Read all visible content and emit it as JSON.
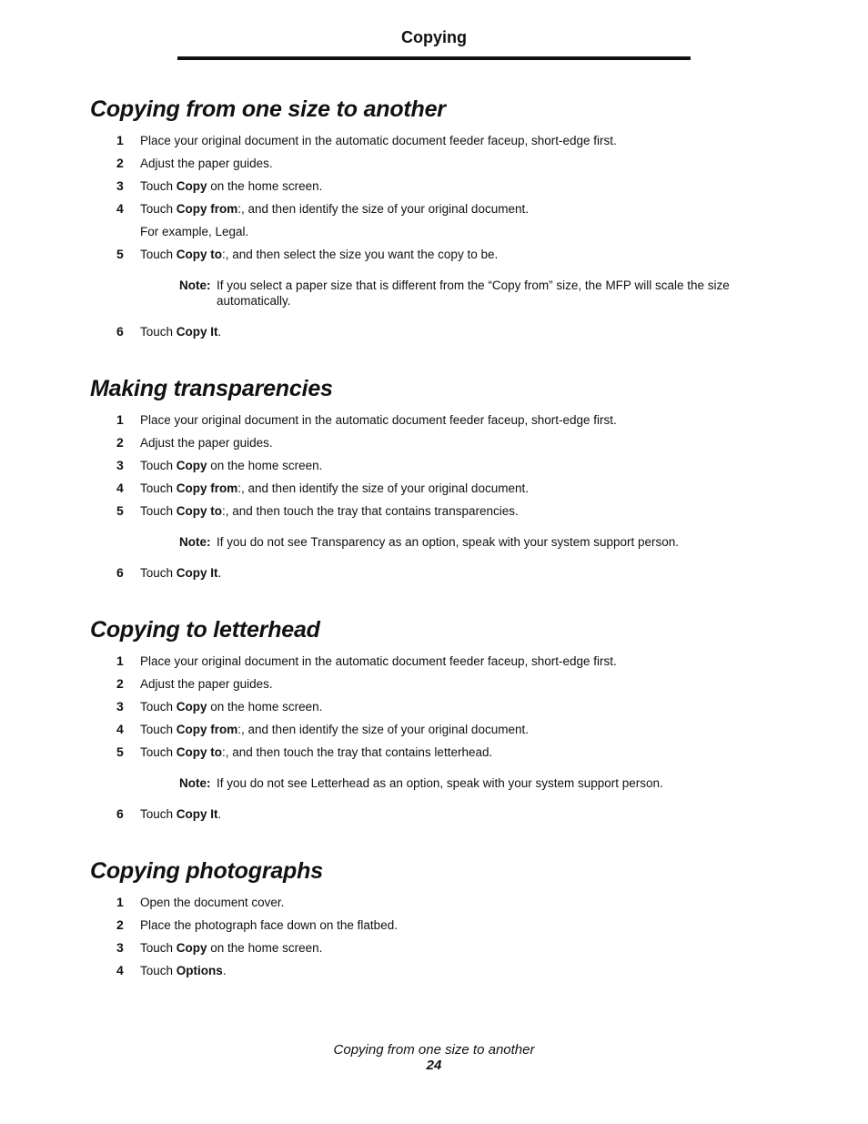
{
  "running_head": "Copying",
  "sections": [
    {
      "title": "Copying from one size to another",
      "steps": [
        {
          "num": "1",
          "pre": "Place your original document in the automatic document feeder faceup, short-edge first.",
          "bold": "",
          "post": ""
        },
        {
          "num": "2",
          "pre": "Adjust the paper guides.",
          "bold": "",
          "post": ""
        },
        {
          "num": "3",
          "pre": "Touch ",
          "bold": "Copy",
          "post": " on the home screen."
        },
        {
          "num": "4",
          "pre": "Touch ",
          "bold": "Copy from",
          "post": ":, and then identify the size of your original document."
        },
        {
          "num": "",
          "pre": "For example, Legal.",
          "bold": "",
          "post": ""
        },
        {
          "num": "5",
          "pre": "Touch ",
          "bold": "Copy to",
          "post": ":, and then select the size you want the copy to be."
        }
      ],
      "note": {
        "label": "Note:",
        "text": "If you select a paper size that is different from the “Copy from” size, the MFP will scale the size automatically."
      },
      "final_step": {
        "num": "6",
        "pre": "Touch ",
        "bold": "Copy It",
        "post": "."
      }
    },
    {
      "title": "Making transparencies",
      "steps": [
        {
          "num": "1",
          "pre": "Place your original document in the automatic document feeder faceup, short-edge first.",
          "bold": "",
          "post": ""
        },
        {
          "num": "2",
          "pre": "Adjust the paper guides.",
          "bold": "",
          "post": ""
        },
        {
          "num": "3",
          "pre": "Touch ",
          "bold": "Copy",
          "post": " on the home screen."
        },
        {
          "num": "4",
          "pre": "Touch ",
          "bold": "Copy from",
          "post": ":, and then identify the size of your original document."
        },
        {
          "num": "5",
          "pre": "Touch ",
          "bold": "Copy to",
          "post": ":, and then touch the tray that contains transparencies."
        }
      ],
      "note": {
        "label": "Note:",
        "text": "If you do not see Transparency as an option, speak with your system support person."
      },
      "final_step": {
        "num": "6",
        "pre": "Touch ",
        "bold": "Copy It",
        "post": "."
      }
    },
    {
      "title": "Copying to letterhead",
      "steps": [
        {
          "num": "1",
          "pre": "Place your original document in the automatic document feeder faceup, short-edge first.",
          "bold": "",
          "post": ""
        },
        {
          "num": "2",
          "pre": "Adjust the paper guides.",
          "bold": "",
          "post": ""
        },
        {
          "num": "3",
          "pre": "Touch ",
          "bold": "Copy",
          "post": " on the home screen."
        },
        {
          "num": "4",
          "pre": "Touch ",
          "bold": "Copy from",
          "post": ":, and then identify the size of your original document."
        },
        {
          "num": "5",
          "pre": "Touch ",
          "bold": "Copy to",
          "post": ":, and then touch the tray that contains letterhead."
        }
      ],
      "note": {
        "label": "Note:",
        "text": "If you do not see Letterhead as an option, speak with your system support person."
      },
      "final_step": {
        "num": "6",
        "pre": "Touch ",
        "bold": "Copy It",
        "post": "."
      }
    },
    {
      "title": "Copying photographs",
      "steps": [
        {
          "num": "1",
          "pre": "Open the document cover.",
          "bold": "",
          "post": ""
        },
        {
          "num": "2",
          "pre": "Place the photograph face down on the flatbed.",
          "bold": "",
          "post": ""
        },
        {
          "num": "3",
          "pre": "Touch ",
          "bold": "Copy",
          "post": " on the home screen."
        },
        {
          "num": "4",
          "pre": "Touch ",
          "bold": "Options",
          "post": "."
        }
      ]
    }
  ],
  "footer": {
    "section_title": "Copying from one size to another",
    "page_number": "24"
  }
}
